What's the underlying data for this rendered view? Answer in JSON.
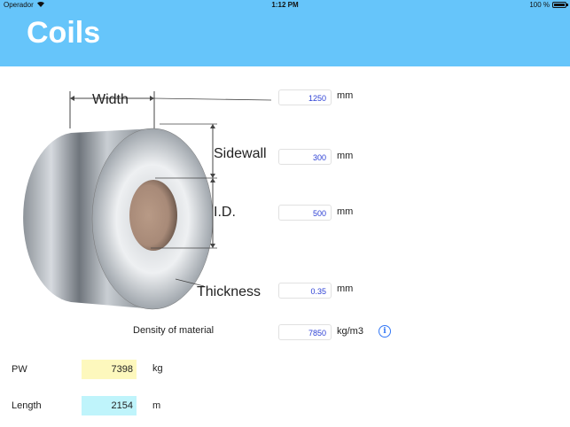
{
  "status": {
    "carrier": "Operador",
    "time": "1:12 PM",
    "battery": "100 %"
  },
  "nav": {
    "title": "Coils"
  },
  "diagram": {
    "width_label": "Width",
    "sidewall_label": "Sidewall",
    "id_label": "I.D.",
    "thickness_label": "Thickness"
  },
  "inputs": {
    "width": {
      "value": "1250",
      "unit": "mm"
    },
    "sidewall": {
      "value": "300",
      "unit": "mm"
    },
    "id": {
      "value": "500",
      "unit": "mm"
    },
    "thickness": {
      "value": "0.35",
      "unit": "mm"
    },
    "density": {
      "label": "Density of material",
      "value": "7850",
      "unit": "kg/m3"
    }
  },
  "results": {
    "pw": {
      "label": "PW",
      "value": "7398",
      "unit": "kg"
    },
    "length": {
      "label": "Length",
      "value": "2154",
      "unit": "m"
    }
  },
  "colors": {
    "header": "#66c5fa",
    "input_text": "#2b3fd4",
    "pw_bg": "#fdf8bd",
    "length_bg": "#bff4fb",
    "info": "#3478f6"
  }
}
